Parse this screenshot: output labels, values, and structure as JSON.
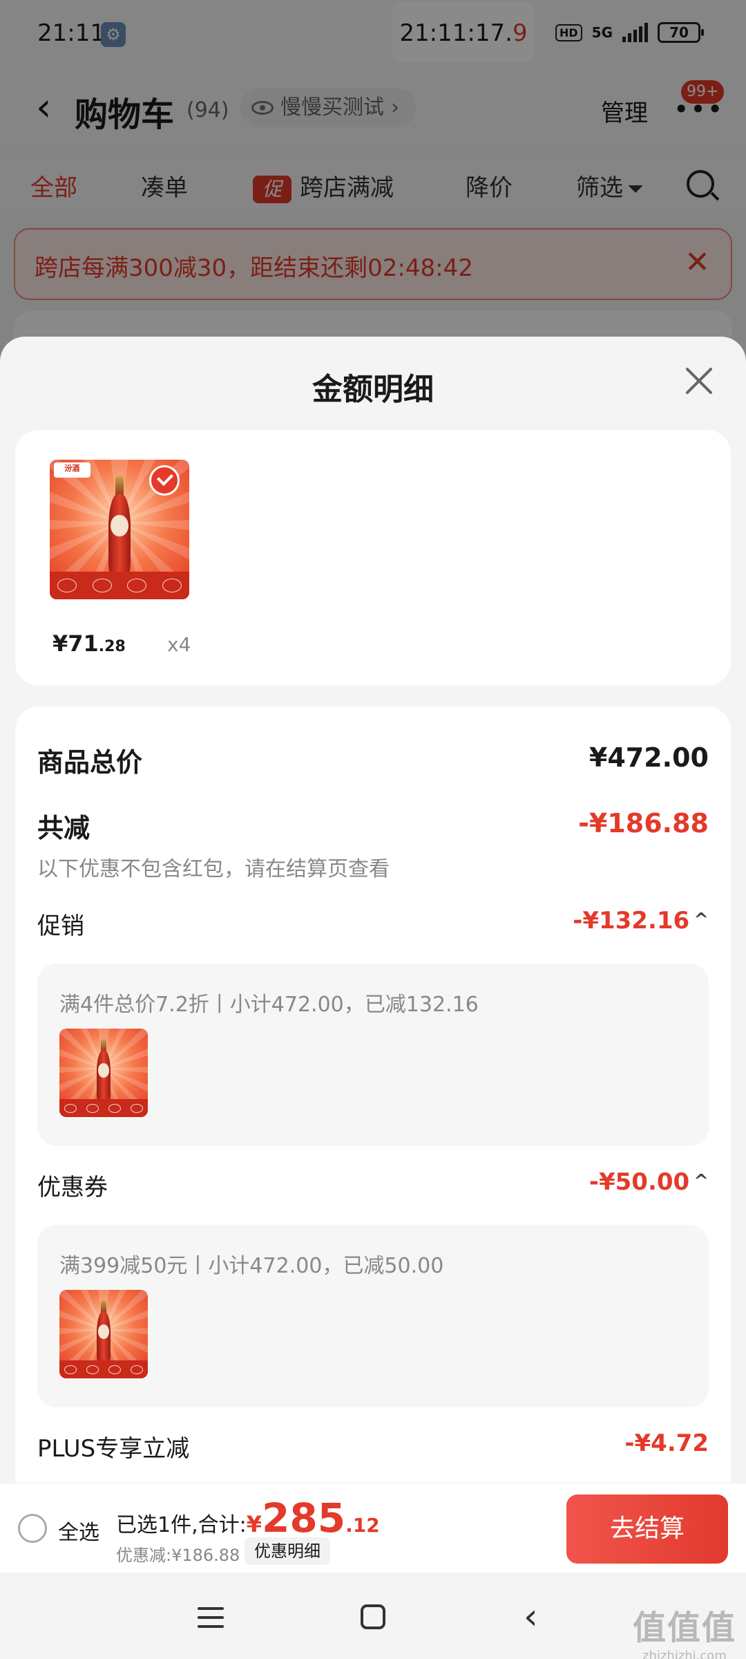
{
  "status_bar": {
    "time": "21:11",
    "clock_main": "21:11:17.",
    "clock_red": "9",
    "hd": "HD",
    "network": "5G",
    "battery": "70"
  },
  "nav": {
    "title": "购物车",
    "count": "(94)",
    "tag_label": "慢慢买测试",
    "tag_chevron": "›",
    "manage_label": "管理",
    "more_glyph": "•••",
    "badge": "99+"
  },
  "tabs": {
    "all": "全部",
    "combine": "凑单",
    "promo_icon_text": "促",
    "cross_store": "跨店满减",
    "price_drop": "降价",
    "filter": "筛选"
  },
  "promo_banner": {
    "text": "跨店每满300减30，距结束还剩02:48:42",
    "close_glyph": "✕"
  },
  "sheet": {
    "title": "金额明细",
    "product": {
      "brand_text": "汾酒",
      "price_currency": "¥",
      "price_int": "71",
      "price_dec": ".28",
      "quantity": "x4"
    },
    "total_label": "商品总价",
    "total_value": "¥472.00",
    "reduce_label": "共减",
    "reduce_value": "-¥186.88",
    "note": "以下优惠不包含红包，请在结算页查看",
    "promotion": {
      "label": "促销",
      "value": "-¥132.16",
      "caret": "^",
      "detail": "满4件总价7.2折丨小计472.00，已减132.16"
    },
    "coupon": {
      "label": "优惠券",
      "value": "-¥50.00",
      "caret": "^",
      "detail": "满399减50元丨小计472.00，已减50.00"
    },
    "plus": {
      "label": "PLUS专享立减",
      "value": "-¥4.72"
    }
  },
  "bottom_bar": {
    "select_all": "全选",
    "selected_prefix": "已选1件,合计:",
    "total_currency": "¥",
    "total_int": "285",
    "total_dec": ".12",
    "saved": "优惠减:¥186.88",
    "detail_button": "优惠明细",
    "checkout_button": "去结算"
  },
  "system_nav": {
    "back_glyph": "‹"
  },
  "watermark": {
    "glyphs": "值值值",
    "url": "zhizhizhi.com"
  },
  "colors": {
    "accent_red": "#e33a2a",
    "sheet_bg": "#f4f4f4",
    "card_bg": "#ffffff"
  }
}
